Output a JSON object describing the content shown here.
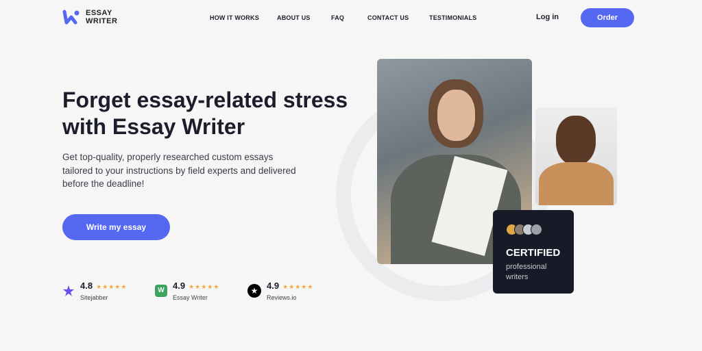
{
  "header": {
    "logo_line1": "ESSAY",
    "logo_line2": "WRITER",
    "nav": [
      "HOW IT WORKS",
      "ABOUT US",
      "FAQ",
      "CONTACT US",
      "TESTIMONIALS"
    ],
    "login": "Log in",
    "order": "Order"
  },
  "hero": {
    "title": "Forget essay-related stress with Essay Writer",
    "subtitle": "Get top-quality, properly researched custom essays tailored to your instructions by field experts and delivered before the deadline!",
    "cta": "Write my essay"
  },
  "ratings": [
    {
      "score": "4.8",
      "source": "Sitejabber",
      "stars": 4.8,
      "icon": "sitejabber-icon"
    },
    {
      "score": "4.9",
      "source": "Essay Writer",
      "stars": 4.9,
      "icon": "essay-writer-icon"
    },
    {
      "score": "4.9",
      "source": "Reviews.io",
      "stars": 4.9,
      "icon": "reviews-io-icon"
    }
  ],
  "card": {
    "title": "CERTIFIED",
    "text": "professional writers"
  },
  "colors": {
    "accent": "#5468f2",
    "card_bg": "#171a27",
    "star": "#f4a93a"
  }
}
